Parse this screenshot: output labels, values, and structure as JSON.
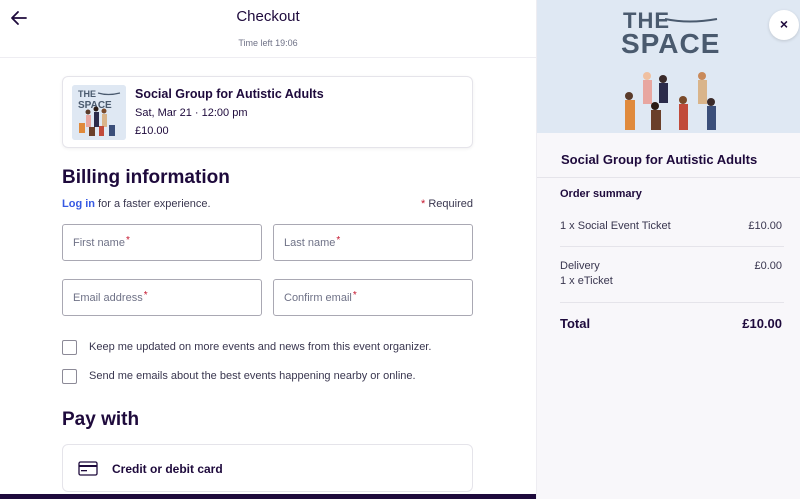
{
  "header": {
    "title": "Checkout",
    "timer": "Time left 19:06"
  },
  "event": {
    "name": "Social Group for Autistic Adults",
    "date": "Sat, Mar 21 · 12:00 pm",
    "price": "£10.00",
    "thumb_the": "THE",
    "thumb_space": "SPACE"
  },
  "billing": {
    "title": "Billing information",
    "login_link": "Log in",
    "login_rest": " for a faster experience.",
    "required_star": "*",
    "required_label": " Required",
    "fields": {
      "first_name": "First name",
      "last_name": "Last name",
      "email": "Email address",
      "confirm_email": "Confirm email"
    },
    "field_star": "*",
    "checkbox_1": "Keep me updated on more events and news from this event organizer.",
    "checkbox_2": "Send me emails about the best events happening nearby or online."
  },
  "pay": {
    "title": "Pay with",
    "option": "Credit or debit card"
  },
  "sidebar": {
    "logo_the": "THE",
    "logo_space": "SPACE",
    "close": "×",
    "event_title": "Social Group for Autistic Adults",
    "summary_title": "Order summary",
    "item_label": "1 x Social Event Ticket",
    "item_price": "£10.00",
    "delivery_label": "Delivery",
    "delivery_sub": "1 x eTicket",
    "delivery_price": "£0.00",
    "total_label": "Total",
    "total_value": "£10.00"
  },
  "colors": {
    "text": "#1e0a3c",
    "link": "#3659e3",
    "required": "#c5162e",
    "banner": "#dfe8f3"
  }
}
